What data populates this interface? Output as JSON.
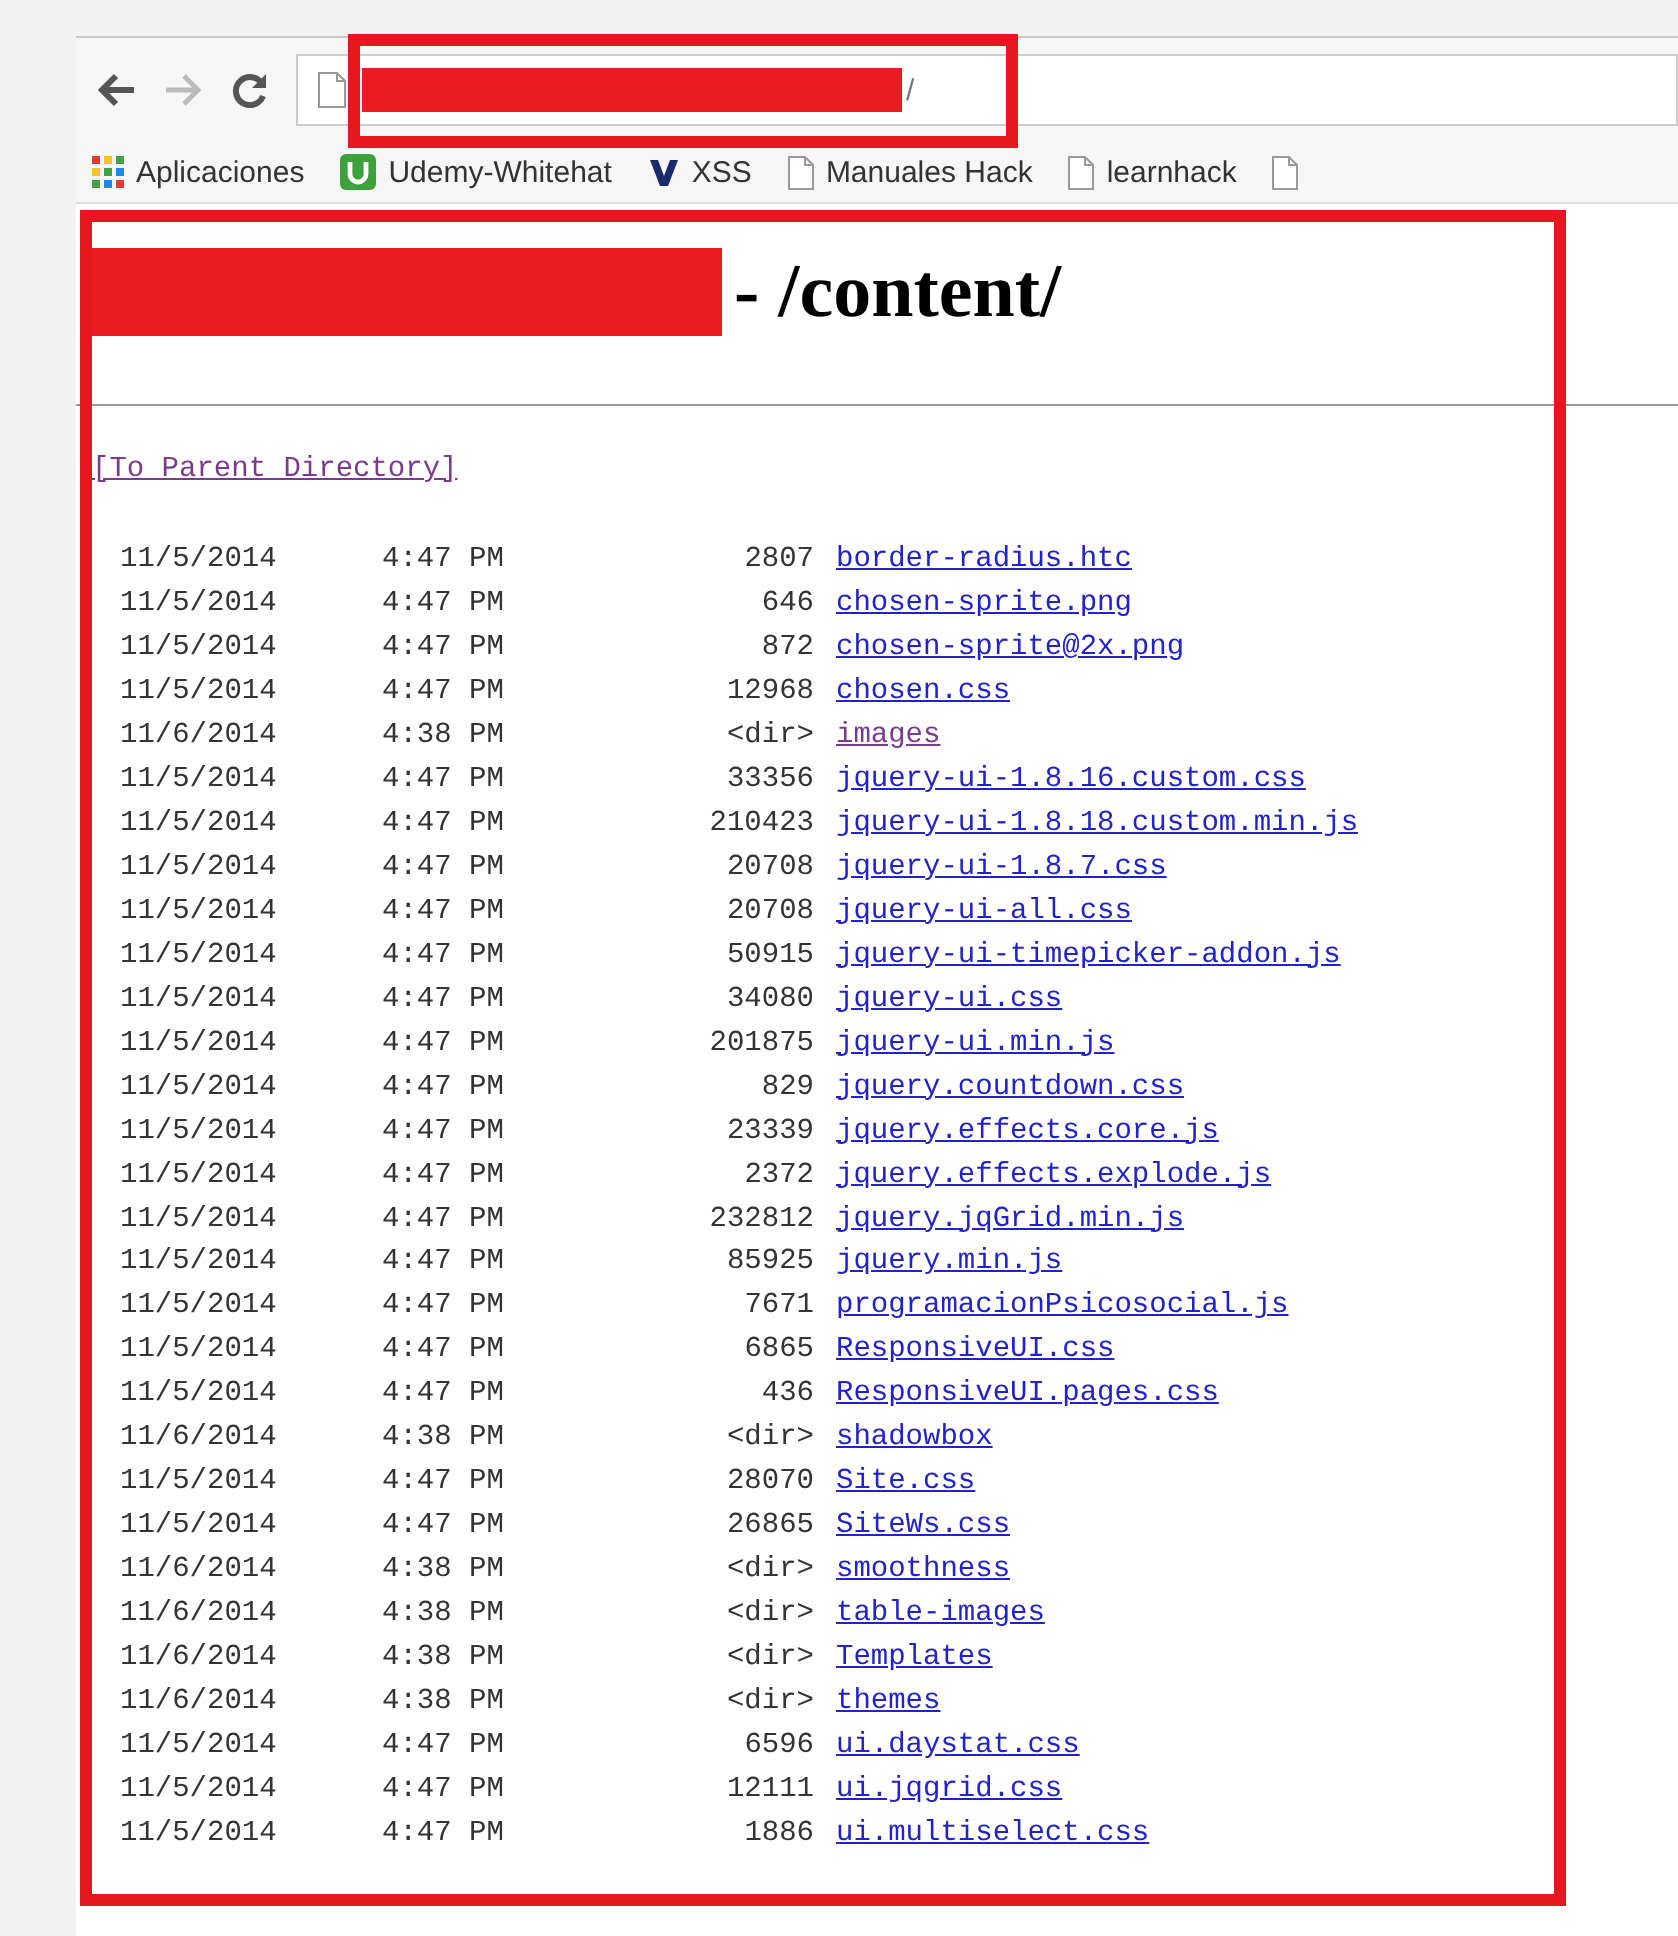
{
  "toolbar": {
    "url": "/"
  },
  "bookmarks": [
    {
      "kind": "apps",
      "label": "Aplicaciones"
    },
    {
      "kind": "udemy",
      "label": "Udemy-Whitehat"
    },
    {
      "kind": "v",
      "label": "XSS"
    },
    {
      "kind": "page",
      "label": "Manuales Hack"
    },
    {
      "kind": "page",
      "label": "learnhack"
    },
    {
      "kind": "page"
    }
  ],
  "page": {
    "heading": "- /content/",
    "parent_link": {
      "label": "[To Parent Directory]",
      "visited": true
    },
    "entries": [
      {
        "date": "11/5/2014",
        "time": "4:47 PM",
        "size": "2807",
        "name": "border-radius.htc",
        "visited": false
      },
      {
        "date": "11/5/2014",
        "time": "4:47 PM",
        "size": "646",
        "name": "chosen-sprite.png",
        "visited": false
      },
      {
        "date": "11/5/2014",
        "time": "4:47 PM",
        "size": "872",
        "name": "chosen-sprite@2x.png",
        "visited": false
      },
      {
        "date": "11/5/2014",
        "time": "4:47 PM",
        "size": "12968",
        "name": "chosen.css",
        "visited": false
      },
      {
        "date": "11/6/2014",
        "time": "4:38 PM",
        "size": "<dir>",
        "name": "images",
        "visited": true
      },
      {
        "date": "11/5/2014",
        "time": "4:47 PM",
        "size": "33356",
        "name": "jquery-ui-1.8.16.custom.css",
        "visited": false
      },
      {
        "date": "11/5/2014",
        "time": "4:47 PM",
        "size": "210423",
        "name": "jquery-ui-1.8.18.custom.min.js",
        "visited": false
      },
      {
        "date": "11/5/2014",
        "time": "4:47 PM",
        "size": "20708",
        "name": "jquery-ui-1.8.7.css",
        "visited": false
      },
      {
        "date": "11/5/2014",
        "time": "4:47 PM",
        "size": "20708",
        "name": "jquery-ui-all.css",
        "visited": false
      },
      {
        "date": "11/5/2014",
        "time": "4:47 PM",
        "size": "50915",
        "name": "jquery-ui-timepicker-addon.js",
        "visited": false
      },
      {
        "date": "11/5/2014",
        "time": "4:47 PM",
        "size": "34080",
        "name": "jquery-ui.css",
        "visited": false
      },
      {
        "date": "11/5/2014",
        "time": "4:47 PM",
        "size": "201875",
        "name": "jquery-ui.min.js",
        "visited": false
      },
      {
        "date": "11/5/2014",
        "time": "4:47 PM",
        "size": "829",
        "name": "jquery.countdown.css",
        "visited": false
      },
      {
        "date": "11/5/2014",
        "time": "4:47 PM",
        "size": "23339",
        "name": "jquery.effects.core.js",
        "visited": false
      },
      {
        "date": "11/5/2014",
        "time": "4:47 PM",
        "size": "2372",
        "name": "jquery.effects.explode.js",
        "visited": false
      },
      {
        "date": "11/5/2014",
        "time": "4:47 PM",
        "size": "232812",
        "name": "jquery.jqGrid.min.js",
        "visited": false
      },
      {
        "date": "11/5/2014",
        "time": "4:47 PM",
        "size": "85925",
        "name": "jquery.min.js",
        "visited": false
      },
      {
        "date": "11/5/2014",
        "time": "4:47 PM",
        "size": "7671",
        "name": "programacionPsicosocial.js",
        "visited": false
      },
      {
        "date": "11/5/2014",
        "time": "4:47 PM",
        "size": "6865",
        "name": "ResponsiveUI.css",
        "visited": false
      },
      {
        "date": "11/5/2014",
        "time": "4:47 PM",
        "size": "436",
        "name": "ResponsiveUI.pages.css",
        "visited": false
      },
      {
        "date": "11/6/2014",
        "time": "4:38 PM",
        "size": "<dir>",
        "name": "shadowbox",
        "visited": false
      },
      {
        "date": "11/5/2014",
        "time": "4:47 PM",
        "size": "28070",
        "name": "Site.css",
        "visited": false
      },
      {
        "date": "11/5/2014",
        "time": "4:47 PM",
        "size": "26865",
        "name": "SiteWs.css",
        "visited": false
      },
      {
        "date": "11/6/2014",
        "time": "4:38 PM",
        "size": "<dir>",
        "name": "smoothness",
        "visited": false
      },
      {
        "date": "11/6/2014",
        "time": "4:38 PM",
        "size": "<dir>",
        "name": "table-images",
        "visited": false
      },
      {
        "date": "11/6/2014",
        "time": "4:38 PM",
        "size": "<dir>",
        "name": "Templates",
        "visited": false
      },
      {
        "date": "11/6/2014",
        "time": "4:38 PM",
        "size": "<dir>",
        "name": "themes",
        "visited": false
      },
      {
        "date": "11/5/2014",
        "time": "4:47 PM",
        "size": "6596",
        "name": "ui.daystat.css",
        "visited": false
      },
      {
        "date": "11/5/2014",
        "time": "4:47 PM",
        "size": "12111",
        "name": "ui.jqgrid.css",
        "visited": false
      },
      {
        "date": "11/5/2014",
        "time": "4:47 PM",
        "size": "1886",
        "name": "ui.multiselect.css",
        "visited": false
      }
    ]
  }
}
